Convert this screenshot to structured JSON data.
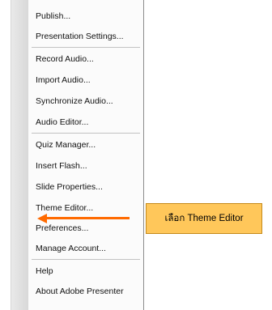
{
  "menu": {
    "items": [
      {
        "label": "Publish..."
      },
      {
        "label": "Presentation Settings..."
      },
      {
        "label": "Record Audio..."
      },
      {
        "label": "Import Audio..."
      },
      {
        "label": "Synchronize Audio..."
      },
      {
        "label": "Audio Editor..."
      },
      {
        "label": "Quiz Manager..."
      },
      {
        "label": "Insert Flash..."
      },
      {
        "label": "Slide Properties..."
      },
      {
        "label": "Theme Editor..."
      },
      {
        "label": "Preferences..."
      },
      {
        "label": "Manage Account..."
      },
      {
        "label": "Help"
      },
      {
        "label": "About Adobe Presenter"
      }
    ]
  },
  "annotation": {
    "callout_text": "เลือก Theme Editor",
    "accent_color": "#ff6a00",
    "callout_color": "#ffc75a"
  }
}
